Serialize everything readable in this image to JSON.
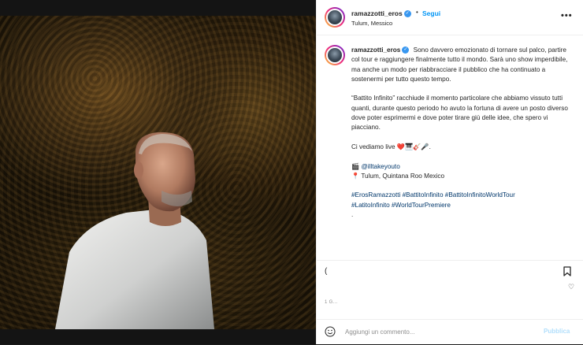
{
  "post": {
    "username": "ramazzotti_eros",
    "verified_mark": "✓",
    "separator": "•",
    "follow_label": "Segui",
    "location": "Tulum, Messico",
    "more_label": "•••"
  },
  "caption": {
    "username": "ramazzotti_eros",
    "paragraph1": "Sono davvero emozionato di tornare sul palco, partire col tour e raggiungere finalmente tutto il mondo. Sarà uno show imperdibile, ma anche un modo per riabbracciare il pubblico che ha continuato a sostenermi per tutto questo tempo.",
    "paragraph2": "“Battito Infinito” racchiude il momento particolare che abbiamo vissuto tutti quanti, durante questo periodo ho avuto la fortuna di avere un posto diverso dove poter esprimermi e dove poter tirare giù delle idee, che spero vi piacciano.",
    "paragraph3": "Ci vediamo live ❤️🎹🎸🎤.",
    "credit_icon": "🎬",
    "credit_mention": "@illtakeyouto",
    "place_icon": "📍",
    "place": "Tulum, Quintana Roo Mexico",
    "hashtags_line1": "#ErosRamazzotti #BattitoInfinito #BattitoInfinitoWorldTour",
    "hashtags_line2": "#LatitoInfinito #WorldTourPremiere",
    "trailing_dot": "."
  },
  "icons": {
    "small_heart": "heart-icon",
    "action_icon": "comment-icon",
    "bookmark": "bookmark-icon",
    "emoji": "emoji-icon"
  },
  "action_icon_glyph": "(",
  "small_heart_glyph": "♡",
  "likes_text": "",
  "date_text": "1 G...",
  "comment": {
    "placeholder": "Aggiungi un commento...",
    "value": "",
    "publish_label": "Pubblica"
  },
  "colors": {
    "accent": "#0095f6",
    "publish_disabled": "#b2dffc",
    "hashtag": "#00376b"
  }
}
